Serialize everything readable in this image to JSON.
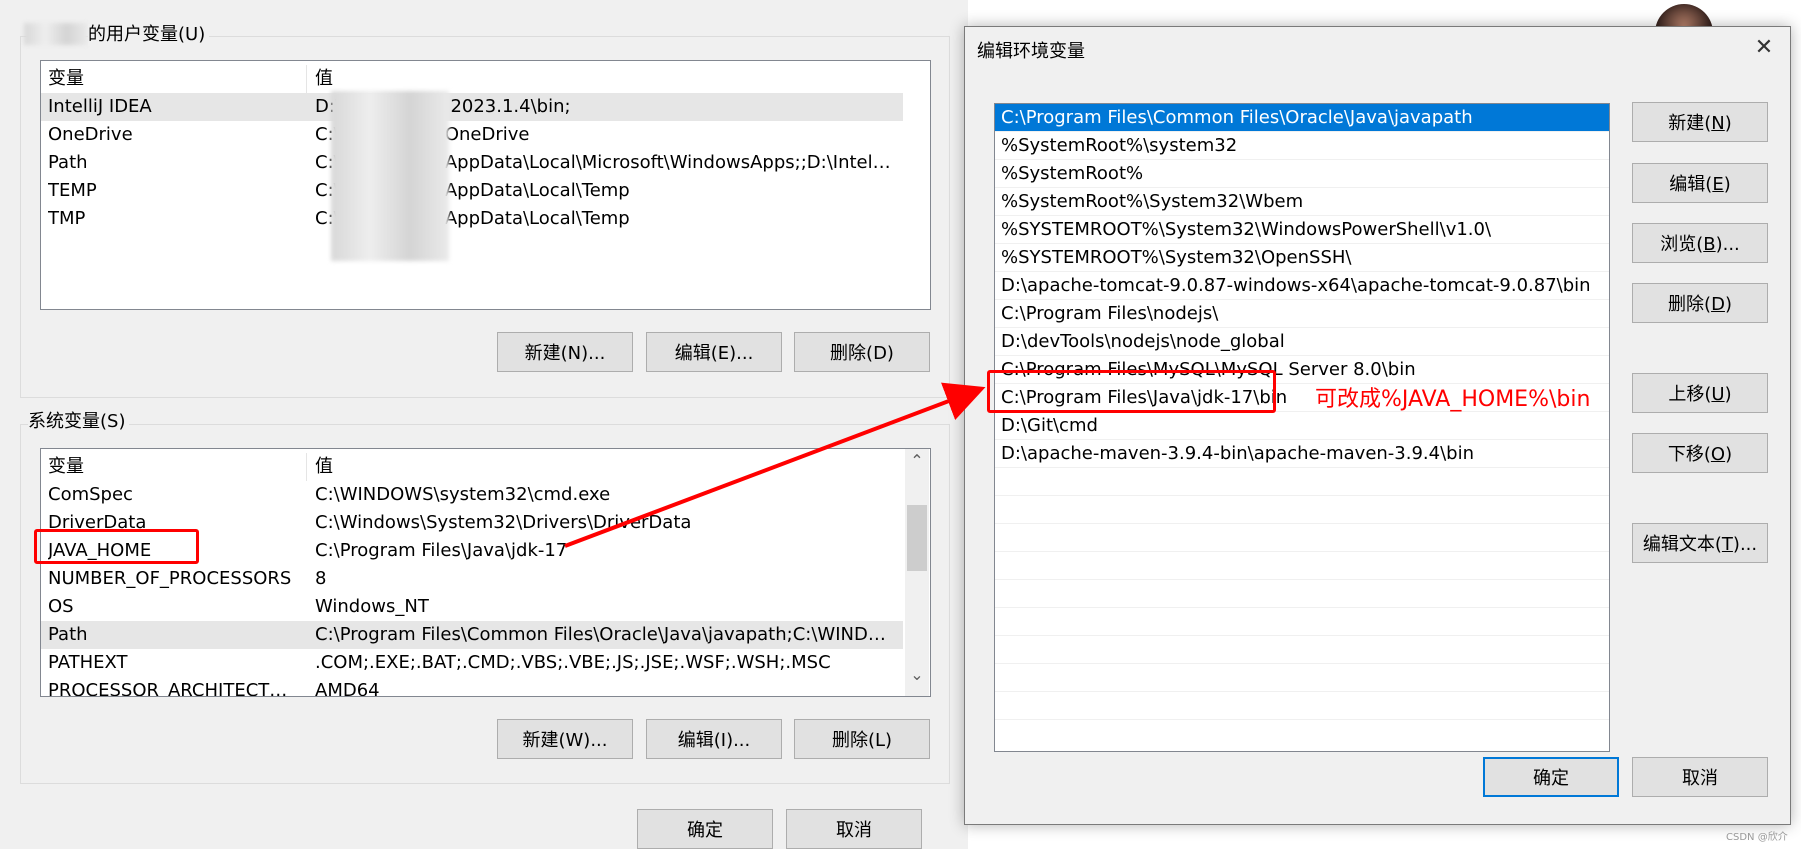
{
  "user_vars": {
    "group_label_suffix": "的用户变量(U)",
    "headers": {
      "name": "变量",
      "value": "值"
    },
    "rows": [
      {
        "name": "IntelliJ IDEA",
        "value": "D:\\IntelliJ IDEA 2023.1.4\\bin;"
      },
      {
        "name": "OneDrive",
        "value": "C:\\Users\\xxxx\\OneDrive"
      },
      {
        "name": "Path",
        "value": "C:\\Users\\xxxx\\AppData\\Local\\Microsoft\\WindowsApps;;D:\\Intelli..."
      },
      {
        "name": "TEMP",
        "value": "C:\\Users\\xxxx\\AppData\\Local\\Temp"
      },
      {
        "name": "TMP",
        "value": "C:\\Users\\xxxx\\AppData\\Local\\Temp"
      }
    ],
    "buttons": {
      "new": "新建(N)...",
      "edit": "编辑(E)...",
      "delete": "删除(D)"
    }
  },
  "sys_vars": {
    "group_label": "系统变量(S)",
    "headers": {
      "name": "变量",
      "value": "值"
    },
    "rows": [
      {
        "name": "ComSpec",
        "value": "C:\\WINDOWS\\system32\\cmd.exe"
      },
      {
        "name": "DriverData",
        "value": "C:\\Windows\\System32\\Drivers\\DriverData"
      },
      {
        "name": "JAVA_HOME",
        "value": "C:\\Program Files\\Java\\jdk-17"
      },
      {
        "name": "NUMBER_OF_PROCESSORS",
        "value": "8"
      },
      {
        "name": "OS",
        "value": "Windows_NT"
      },
      {
        "name": "Path",
        "value": "C:\\Program Files\\Common Files\\Oracle\\Java\\javapath;C:\\WINDOW..."
      },
      {
        "name": "PATHEXT",
        "value": ".COM;.EXE;.BAT;.CMD;.VBS;.VBE;.JS;.JSE;.WSF;.WSH;.MSC"
      },
      {
        "name": "PROCESSOR_ARCHITECTURE",
        "value": "AMD64"
      }
    ],
    "buttons": {
      "new": "新建(W)...",
      "edit": "编辑(I)...",
      "delete": "删除(L)"
    },
    "scroll_up_glyph": "⌃",
    "scroll_down_glyph": "⌄"
  },
  "footer_buttons": {
    "ok": "确定",
    "cancel": "取消"
  },
  "edit_dialog": {
    "title": "编辑环境变量",
    "close_glyph": "✕",
    "paths": [
      "C:\\Program Files\\Common Files\\Oracle\\Java\\javapath",
      "%SystemRoot%\\system32",
      "%SystemRoot%",
      "%SystemRoot%\\System32\\Wbem",
      "%SYSTEMROOT%\\System32\\WindowsPowerShell\\v1.0\\",
      "%SYSTEMROOT%\\System32\\OpenSSH\\",
      "D:\\apache-tomcat-9.0.87-windows-x64\\apache-tomcat-9.0.87\\bin",
      "C:\\Program Files\\nodejs\\",
      "D:\\devTools\\nodejs\\node_global",
      "C:\\Program Files\\MySQL\\MySQL Server 8.0\\bin",
      "C:\\Program Files\\Java\\jdk-17\\bin",
      "D:\\Git\\cmd",
      "D:\\apache-maven-3.9.4-bin\\apache-maven-3.9.4\\bin"
    ],
    "selected_index": 0,
    "buttons": {
      "new": {
        "text": "新建(",
        "key": "N",
        "end": ")"
      },
      "edit": {
        "text": "编辑(",
        "key": "E",
        "end": ")"
      },
      "browse": {
        "text": "浏览(",
        "key": "B",
        "end": ")..."
      },
      "delete": {
        "text": "删除(",
        "key": "D",
        "end": ")"
      },
      "move_up": {
        "text": "上移(",
        "key": "U",
        "end": ")"
      },
      "move_down": {
        "text": "下移(",
        "key": "O",
        "end": ")"
      },
      "edit_text": {
        "text": "编辑文本(",
        "key": "T",
        "end": ")..."
      }
    },
    "ok": "确定",
    "cancel": "取消"
  },
  "annotation": {
    "text": "可改成%JAVA_HOME%\\bin",
    "color": "#ff0000"
  },
  "watermark": "CSDN @欣介",
  "colors": {
    "selection": "#0078d7",
    "highlight_box": "#ff0000",
    "default_button_border": "#0078d7"
  }
}
